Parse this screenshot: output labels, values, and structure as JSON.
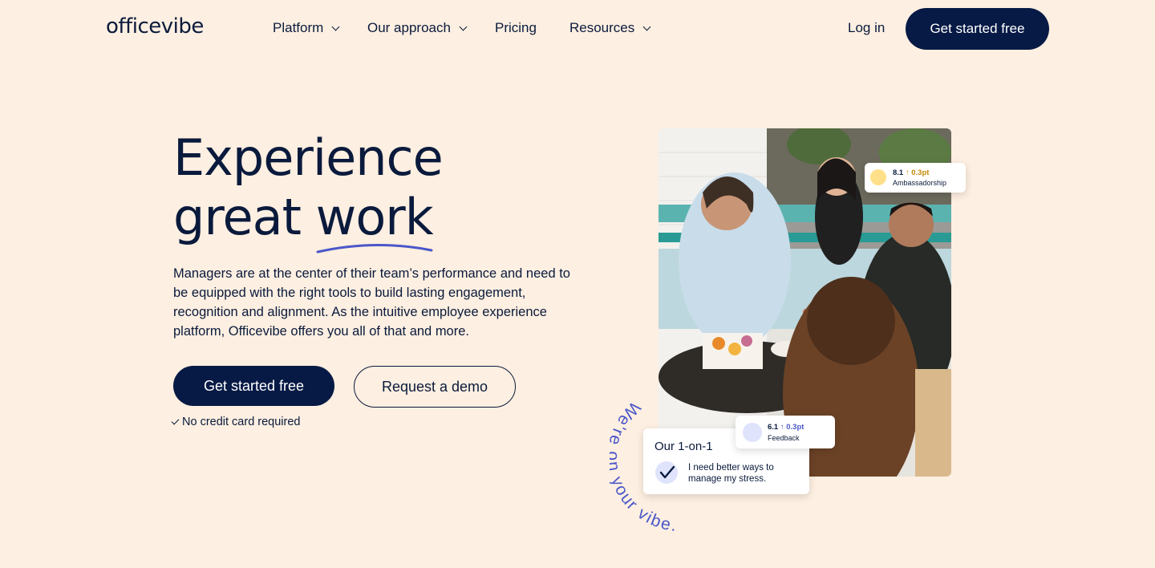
{
  "nav": {
    "logo": "officevibe",
    "items": [
      {
        "label": "Platform",
        "dropdown": true
      },
      {
        "label": "Our approach",
        "dropdown": true
      },
      {
        "label": "Pricing",
        "dropdown": false
      },
      {
        "label": "Resources",
        "dropdown": true
      }
    ],
    "login": "Log in",
    "cta": "Get started free"
  },
  "hero": {
    "title_line1": "Experience",
    "title_line2_a": "great",
    "title_line2_b": "work",
    "description": "Managers are at the center of their team’s performance and need to be equipped with the right tools to build lasting engagement, recognition and alignment. As the intuitive employee experience platform, Officevibe offers you all of that and more.",
    "primary_cta": "Get started free",
    "secondary_cta": "Request a demo",
    "note": "No credit card required"
  },
  "visual": {
    "curved_text": "We're on your vibe.",
    "card_ambassadorship": {
      "score": "8.1",
      "delta": "↑ 0.3pt",
      "label": "Ambassadorship"
    },
    "card_feedback": {
      "score": "6.1",
      "delta": "↑ 0.3pt",
      "label": "Feedback"
    },
    "card_one_on_one": {
      "title": "Our 1-on-1",
      "item": "I need better ways to manage my stress."
    }
  },
  "colors": {
    "background": "#fdefe1",
    "navy": "#071a45",
    "accent_blue": "#4a57c9"
  }
}
